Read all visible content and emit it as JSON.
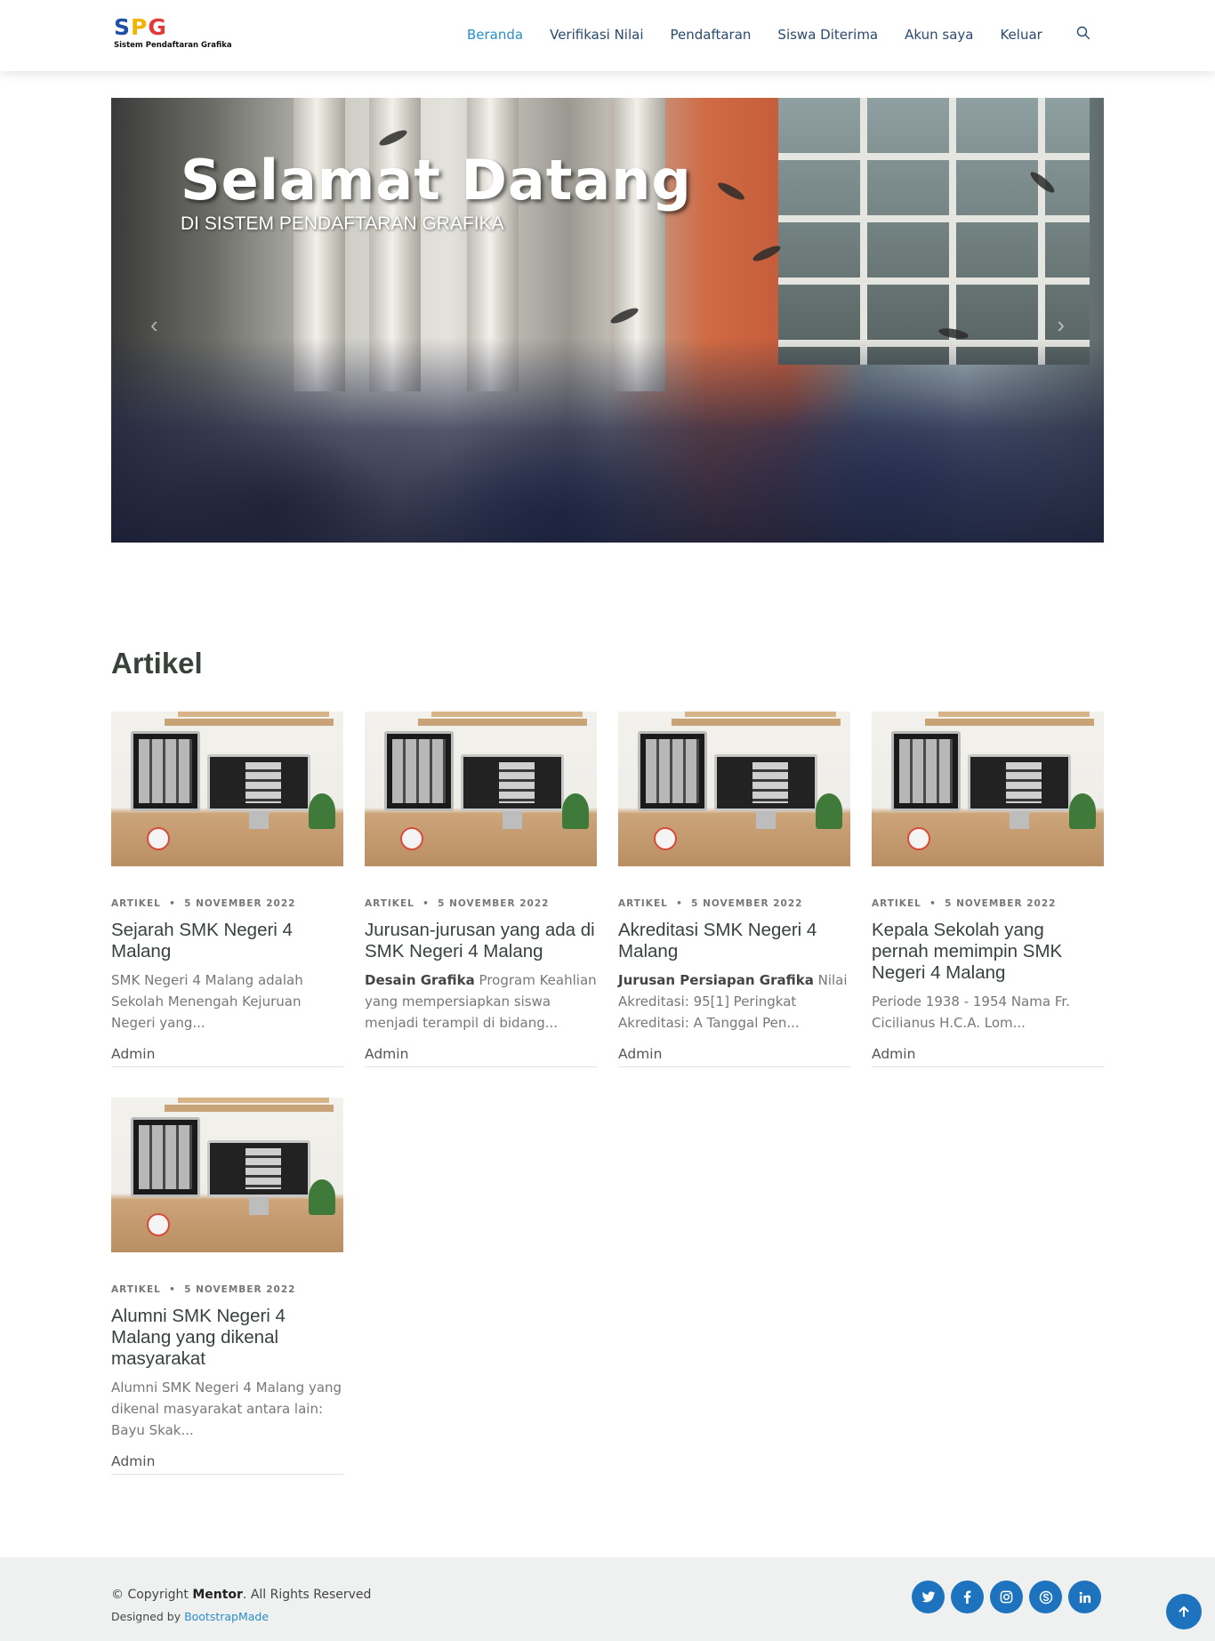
{
  "brand": {
    "mark_s": "S",
    "mark_p": "P",
    "mark_g": "G",
    "tagline": "Sistem Pendaftaran Grafika"
  },
  "nav": {
    "items": [
      {
        "label": "Beranda",
        "active": true
      },
      {
        "label": "Verifikasi Nilai"
      },
      {
        "label": "Pendaftaran"
      },
      {
        "label": "Siswa Diterima"
      },
      {
        "label": "Akun saya"
      },
      {
        "label": "Keluar"
      }
    ],
    "search_icon": "search-icon"
  },
  "hero": {
    "title": "Selamat Datang",
    "subtitle": "DI SISTEM PENDAFTARAN GRAFIKA",
    "prev_icon": "chevron-left-icon",
    "next_icon": "chevron-right-icon"
  },
  "articles": {
    "section_title": "Artikel",
    "items": [
      {
        "category": "ARTIKEL",
        "date": "5 NOVEMBER 2022",
        "title": "Sejarah SMK Negeri 4 Malang",
        "excerpt_bold": "",
        "excerpt": "SMK Negeri 4 Malang adalah Sekolah Menengah Kejuruan Negeri yang...",
        "author": "Admin"
      },
      {
        "category": "ARTIKEL",
        "date": "5 NOVEMBER 2022",
        "title": "Jurusan-jurusan yang ada di SMK Negeri 4 Malang",
        "excerpt_bold": "Desain Grafika",
        "excerpt": " Program Keahlian yang mempersiapkan siswa menjadi terampil di bidang...",
        "author": "Admin"
      },
      {
        "category": "ARTIKEL",
        "date": "5 NOVEMBER 2022",
        "title": "Akreditasi SMK Negeri 4 Malang",
        "excerpt_bold": "Jurusan Persiapan Grafika",
        "excerpt": " Nilai Akreditasi: 95[1] Peringkat Akreditasi: A Tanggal Pen...",
        "author": "Admin"
      },
      {
        "category": "ARTIKEL",
        "date": "5 NOVEMBER 2022",
        "title": "Kepala Sekolah yang pernah memimpin SMK Negeri 4 Malang",
        "excerpt_bold": "",
        "excerpt": "Periode 1938 - 1954 Nama Fr. Cicilianus H.C.A. Lom...",
        "author": "Admin"
      },
      {
        "category": "ARTIKEL",
        "date": "5 NOVEMBER 2022",
        "title": "Alumni SMK Negeri 4 Malang yang dikenal masyarakat",
        "excerpt_bold": "",
        "excerpt": "Alumni SMK Negeri 4 Malang yang dikenal masyarakat antara lain: Bayu Skak...",
        "author": "Admin"
      }
    ]
  },
  "footer": {
    "copyright_prefix": "© Copyright ",
    "copyright_brand": "Mentor",
    "copyright_suffix": ". All Rights Reserved",
    "designed_by": "Designed by ",
    "designed_link": "BootstrapMade",
    "social": [
      "twitter-icon",
      "facebook-icon",
      "instagram-icon",
      "skype-icon",
      "linkedin-icon"
    ],
    "back_to_top_icon": "arrow-up-icon"
  },
  "colors": {
    "accent": "#2a8fc7",
    "social_bg": "#1e73be",
    "nav_text": "#2a4a6e",
    "footer_bg": "#eff1f1"
  }
}
